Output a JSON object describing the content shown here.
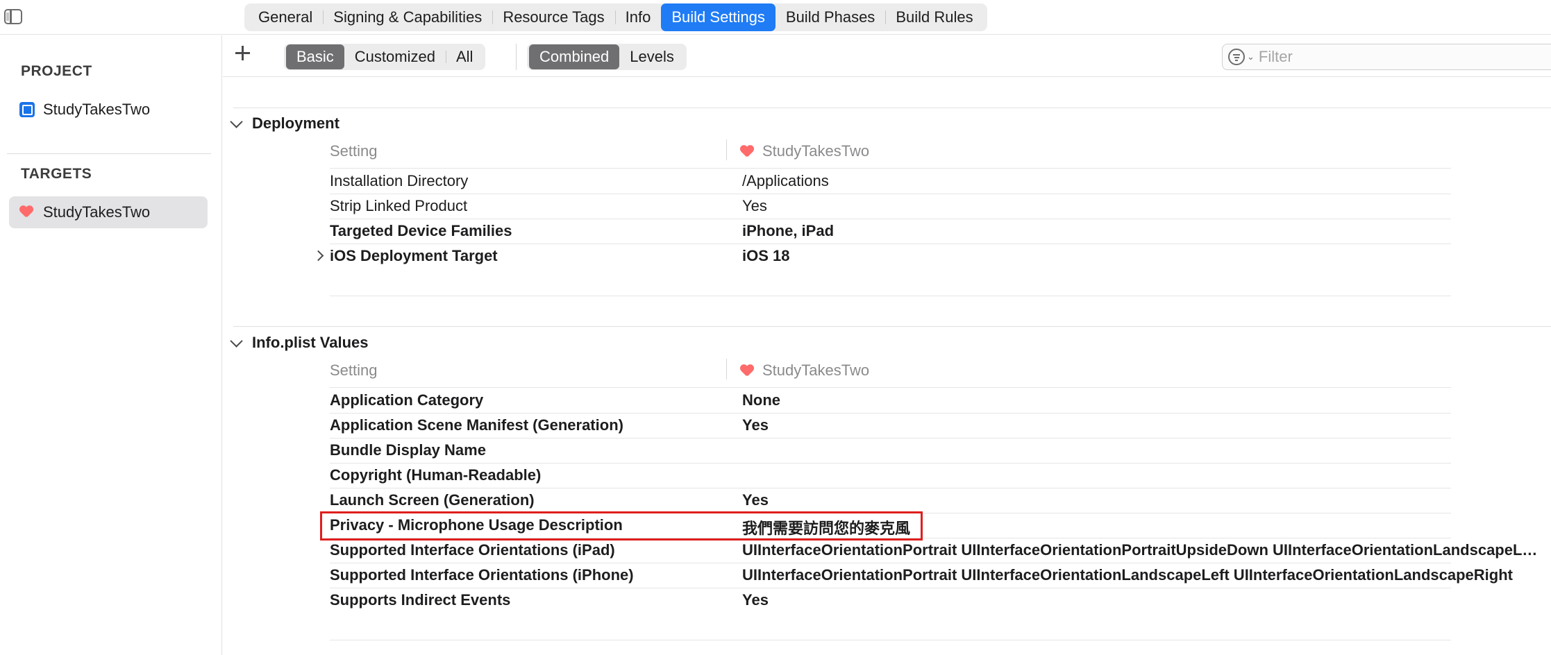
{
  "tabs": [
    {
      "label": "General",
      "active": false
    },
    {
      "label": "Signing & Capabilities",
      "active": false
    },
    {
      "label": "Resource Tags",
      "active": false
    },
    {
      "label": "Info",
      "active": false
    },
    {
      "label": "Build Settings",
      "active": true
    },
    {
      "label": "Build Phases",
      "active": false
    },
    {
      "label": "Build Rules",
      "active": false
    }
  ],
  "sidebar": {
    "project_heading": "PROJECT",
    "project_item": "StudyTakesTwo",
    "targets_heading": "TARGETS",
    "target_item": "StudyTakesTwo"
  },
  "toolbar": {
    "scope_options": [
      "Basic",
      "Customized",
      "All"
    ],
    "scope_selected": "Basic",
    "view_options": [
      "Combined",
      "Levels"
    ],
    "view_selected": "Combined",
    "filter_placeholder": "Filter"
  },
  "deployment": {
    "title": "Deployment",
    "header_setting": "Setting",
    "header_target": "StudyTakesTwo",
    "rows": [
      {
        "key": "Installation Directory",
        "value": "/Applications"
      },
      {
        "key": "Strip Linked Product",
        "value": "Yes"
      },
      {
        "key": "Targeted Device Families",
        "value": "iPhone, iPad"
      },
      {
        "key": "iOS Deployment Target",
        "value": "iOS 18"
      }
    ]
  },
  "infoplist": {
    "title": "Info.plist Values",
    "header_setting": "Setting",
    "header_target": "StudyTakesTwo",
    "rows": [
      {
        "key": "Application Category",
        "value": "None"
      },
      {
        "key": "Application Scene Manifest (Generation)",
        "value": "Yes"
      },
      {
        "key": "Bundle Display Name",
        "value": ""
      },
      {
        "key": "Copyright (Human-Readable)",
        "value": ""
      },
      {
        "key": "Launch Screen (Generation)",
        "value": "Yes"
      },
      {
        "key": "Privacy - Microphone Usage Description",
        "value": "我們需要訪問您的麥克風"
      },
      {
        "key": "Supported Interface Orientations (iPad)",
        "value": "UIInterfaceOrientationPortrait UIInterfaceOrientationPortraitUpsideDown UIInterfaceOrientationLandscapeLeft UIInterfaceOrientationLandscapeRight"
      },
      {
        "key": "Supported Interface Orientations (iPhone)",
        "value": "UIInterfaceOrientationPortrait UIInterfaceOrientationLandscapeLeft UIInterfaceOrientationLandscapeRight"
      },
      {
        "key": "Supports Indirect Events",
        "value": "Yes"
      }
    ]
  },
  "colors": {
    "accent": "#1f7cf5",
    "segment_selected": "#6f6f72",
    "highlight_box": "#e01e1e"
  }
}
